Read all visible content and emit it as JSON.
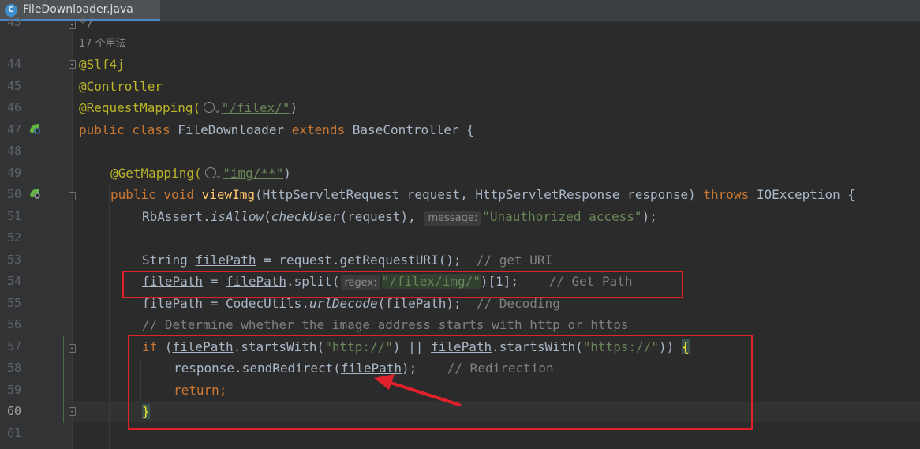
{
  "tab": {
    "icon": "java-class-icon",
    "icon_letter": "C",
    "title": "FileDownloader.java"
  },
  "usages_hint": "17 个用法",
  "line_numbers": [
    "43",
    "44",
    "45",
    "46",
    "47",
    "48",
    "49",
    "50",
    "51",
    "52",
    "53",
    "54",
    "55",
    "56",
    "57",
    "58",
    "59",
    "60",
    "61"
  ],
  "current_line": "60",
  "code": {
    "l43": "*/",
    "l44_ann": "@Slf4j",
    "l45_ann": "@Controller",
    "l46_ann": "@RequestMapping(",
    "l46_str": "\"/filex/\"",
    "l46_end": ")",
    "l47_kw": "public class",
    "l47_name": " FileDownloader ",
    "l47_kw2": "extends",
    "l47_rest": " BaseController {",
    "l49_ann": "@GetMapping(",
    "l49_str": "\"img/**\"",
    "l49_end": ")",
    "l50_kw": "public void",
    "l50_fn": "viewImg",
    "l50_params": "(HttpServletRequest request, HttpServletResponse response) ",
    "l50_throws": "throws",
    "l50_rest": " IOException {",
    "l51_cls": "RbAssert.",
    "l51_m1": "isAllow",
    "l51_p": "(",
    "l51_m2": "checkUser",
    "l51_args": "(request), ",
    "l51_hint": "message:",
    "l51_str": "\"Unauthorized access\"",
    "l51_end": ");",
    "l53_a": "String ",
    "l53_var": "filePath",
    "l53_b": " = request.getRequestURI();  ",
    "l53_cmt": "// get URI",
    "l54_var": "filePath",
    "l54_a": " = ",
    "l54_var2": "filePath",
    "l54_b": ".split(",
    "l54_hint": "regex:",
    "l54_str": "\"/filex/img/\"",
    "l54_c": ")[1];    ",
    "l54_cmt": "// Get Path",
    "l55_var": "filePath",
    "l55_a": " = CodecUtils.",
    "l55_m": "urlDecode",
    "l55_p": "(",
    "l55_var2": "filePath",
    "l55_b": ");  ",
    "l55_cmt": "// Decoding",
    "l56_cmt": "// Determine whether the image address starts with http or https",
    "l57_kw": "if",
    "l57_a": " (",
    "l57_var": "filePath",
    "l57_b": ".startsWith(",
    "l57_str1": "\"http://\"",
    "l57_c": ") || ",
    "l57_var2": "filePath",
    "l57_d": ".startsWith(",
    "l57_str2": "\"https://\"",
    "l57_e": ")) ",
    "l57_brace": "{",
    "l58_a": "response.sendRedirect(",
    "l58_var": "filePath",
    "l58_b": ");    ",
    "l58_cmt": "// Redirection",
    "l59_kw": "return",
    "l59_end": ";",
    "l60_brace": "}"
  },
  "colors": {
    "annotation_box": "#e0202a",
    "arrow": "#e0202a",
    "background": "#2b2b2b"
  }
}
